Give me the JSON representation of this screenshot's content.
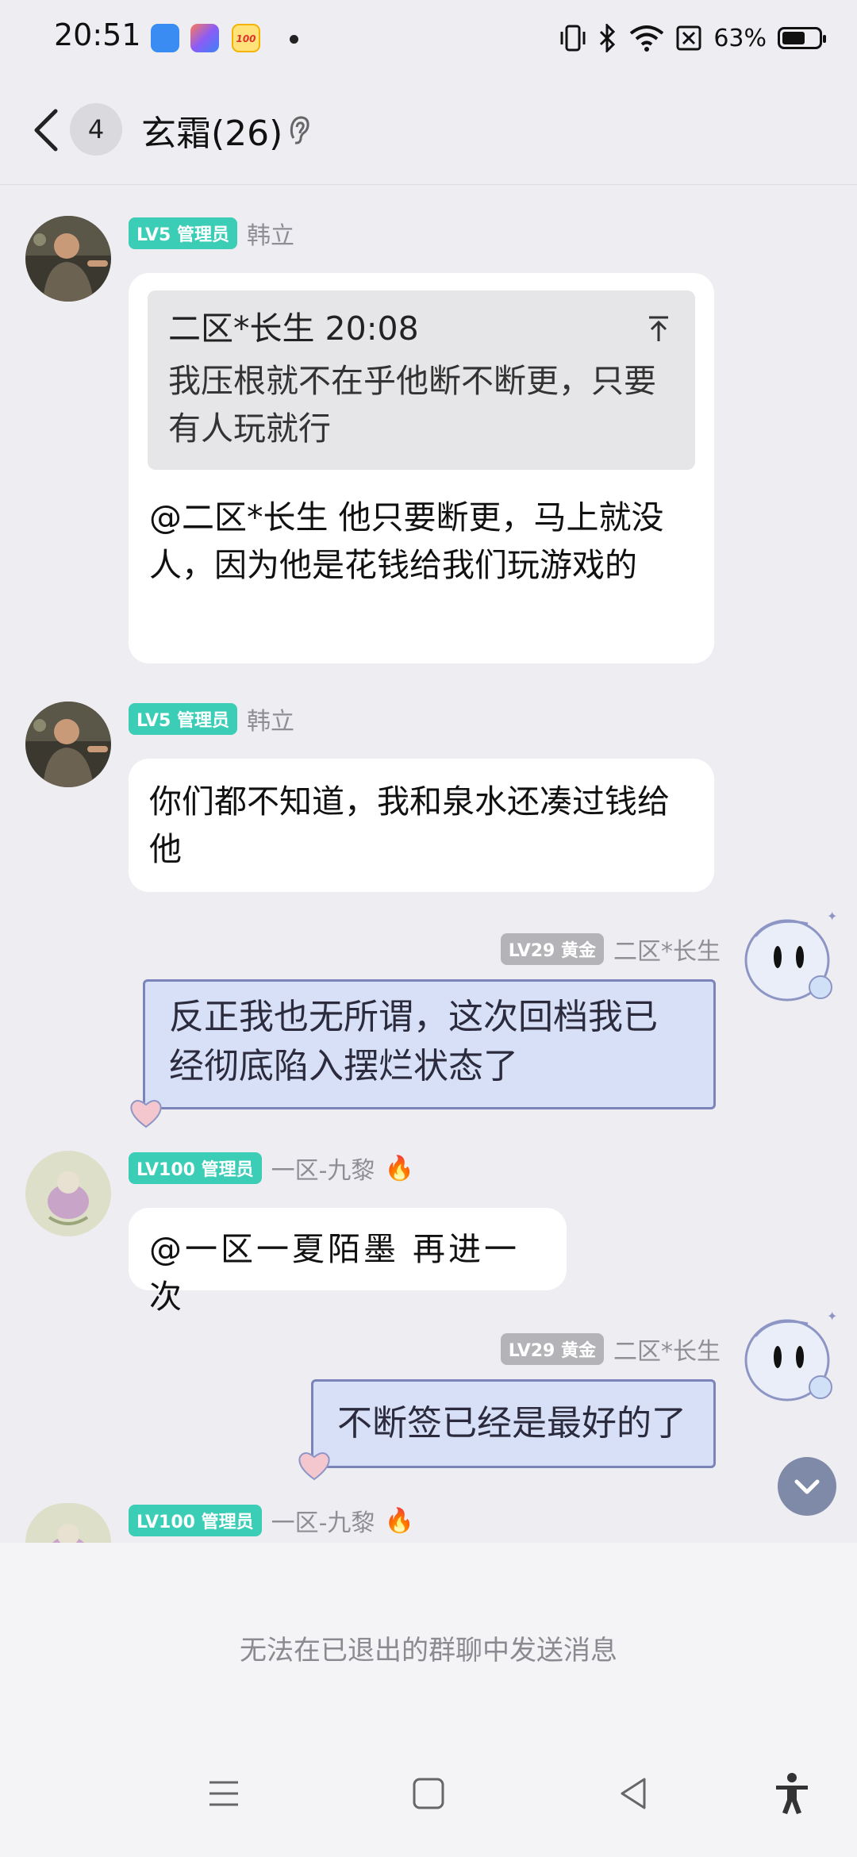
{
  "status_bar": {
    "time": "20:51",
    "battery": "63%",
    "battery_level": 0.63,
    "icons": [
      "vibrate-icon",
      "bluetooth-icon",
      "wifi-icon",
      "no-sim-icon",
      "battery-icon"
    ]
  },
  "header": {
    "back_icon": "chevron-left-icon",
    "unread_count": "4",
    "title": "玄霜(26)",
    "ear_icon": "ear-icon"
  },
  "messages": [
    {
      "level": "LV5 管理员",
      "name": "韩立",
      "quote": {
        "author_time": "二区*长生 20:08",
        "text": "我压根就不在乎他断不断更，只要有人玩就行"
      },
      "text": "@二区*长生 他只要断更，马上就没人，因为他是花钱给我们玩游戏的"
    },
    {
      "level": "LV5 管理员",
      "name": "韩立",
      "text": "你们都不知道，我和泉水还凑过钱给他"
    },
    {
      "level": "LV29 黄金",
      "name": "二区*长生",
      "text": "反正我也无所谓，这次回档我已经彻底陷入摆烂状态了",
      "self": true
    },
    {
      "level": "LV100 管理员",
      "name": "一区-九黎",
      "text": "@一区一夏陌墨 再进一次"
    },
    {
      "level": "LV29 黄金",
      "name": "二区*长生",
      "text": "不断签已经是最好的了",
      "self": true
    },
    {
      "level": "LV100 管理员",
      "name": "一区-九黎"
    }
  ],
  "bottom": {
    "notice": "无法在已退出的群聊中发送消息"
  },
  "colors": {
    "admin_badge": "#3ccdb7",
    "gold_badge": "#b4b4b8",
    "background": "#eeeef2",
    "self_bubble": "#d7e0f7"
  }
}
